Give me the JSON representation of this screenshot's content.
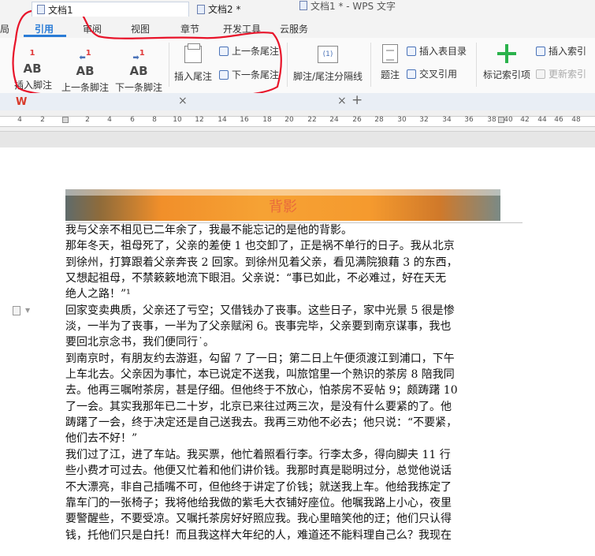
{
  "window": {
    "title": "文档1 * - WPS 文字"
  },
  "ribbon_tabs": [
    {
      "label": "局",
      "active": false
    },
    {
      "label": "引用",
      "active": true
    },
    {
      "label": "审阅",
      "active": false
    },
    {
      "label": "视图",
      "active": false
    },
    {
      "label": "章节",
      "active": false
    },
    {
      "label": "开发工具",
      "active": false
    },
    {
      "label": "云服务",
      "active": false
    }
  ],
  "ribbon": {
    "ab_glyph": "AB",
    "ab_sup": "1",
    "insert_footnote": "插入脚注",
    "prev_footnote": "上一条脚注",
    "next_footnote": "下一条脚注",
    "insert_endnote": "插入尾注",
    "prev_endnote": "上一条尾注",
    "next_endnote": "下一条尾注",
    "separator_label": "脚注/尾注分隔线",
    "separator_icon_text": "(1)",
    "caption": "题注",
    "insert_toc": "插入表目录",
    "cross_ref": "交叉引用",
    "mark_index": "标记索引项",
    "insert_index": "插入索引",
    "update_index": "更新索引"
  },
  "doc_tabs": [
    {
      "label": "文档1",
      "active": true
    },
    {
      "label": "文档2 *",
      "active": false
    }
  ],
  "wps_logo": "W",
  "new_tab": "+",
  "close_glyph": "×",
  "ruler": [
    "4",
    "2",
    "2",
    "4",
    "6",
    "8",
    "10",
    "12",
    "14",
    "16",
    "18",
    "20",
    "22",
    "24",
    "26",
    "28",
    "30",
    "32",
    "34",
    "36",
    "38",
    "40",
    "42",
    "44",
    "46",
    "48"
  ],
  "document": {
    "banner_title": "背影",
    "lines": [
      "我与父亲不相见已二年余了，我最不能忘记的是他的背影。",
      "那年冬天，祖母死了，父亲的差使 1 也交卸了，正是祸不单行的日子。我从北京",
      "到徐州，打算跟着父亲奔丧 2 回家。到徐州见着父亲，看见满院狼藉 3 的东西，",
      "又想起祖母，不禁簌簌地流下眼泪。父亲说：“事已如此，不必难过，好在天无",
      "绝人之路！”¹",
      "回家变卖典质，父亲还了亏空；又借钱办了丧事。这些日子，家中光景 5 很是惨",
      "淡，一半为了丧事，一半为了父亲赋闲 6。丧事完毕，父亲要到南京谋事，我也",
      "要回北京念书，我们便同行˙。",
      "到南京时，有朋友约去游逛，勾留 7 了一日；第二日上午便须渡江到浦口，下午",
      "上车北去。父亲因为事忙，本已说定不送我，叫旅馆里一个熟识的茶房 8 陪我同",
      "去。他再三嘱咐茶房，甚是仔细。但他终于不放心，怕茶房不妥帖 9；颇踌躇 10",
      "了一会。其实我那年已二十岁，北京已来往过两三次，是没有什么要紧的了。他",
      "踌躇了一会，终于决定还是自己送我去。我再三劝他不必去；他只说：“不要紧，",
      "他们去不好！”",
      "我们过了江，进了车站。我买票，他忙着照看行李。行李太多，得向脚夫 11 行",
      "些小费才可过去。他便又忙着和他们讲价钱。我那时真是聪明过分，总觉他说话",
      "不大漂亮，非自己插嘴不可，但他终于讲定了价钱；就送我上车。他给我拣定了",
      "靠车门的一张椅子；我将他给我做的紫毛大衣铺好座位。他嘱我路上小心，夜里",
      "要警醒些，不要受凉。又嘱托茶房好好照应我。我心里暗笑他的迂；他们只认得",
      "钱，托他们只是白托！而且我这样大年纪的人，难道还不能料理自己么？我现在"
    ]
  },
  "colors": {
    "accent": "#2a7cd6",
    "annotation": "#e8142a",
    "footnote_sup": "#e03a3a"
  }
}
